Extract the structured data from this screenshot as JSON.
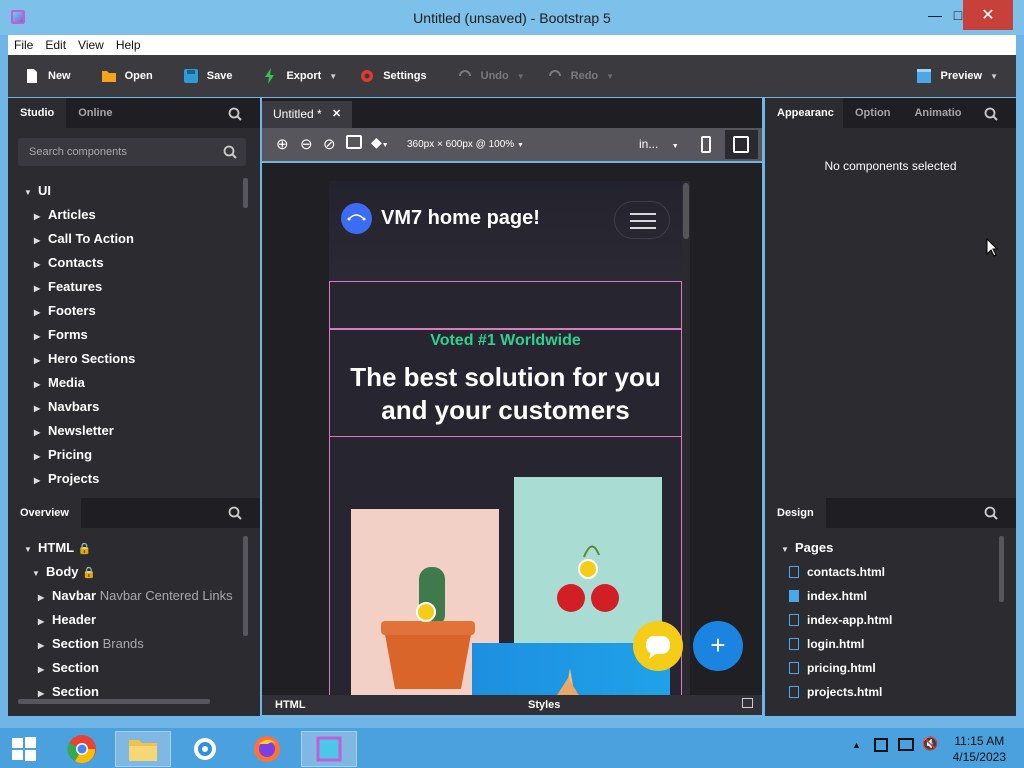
{
  "window": {
    "title": "Untitled (unsaved) - Bootstrap 5"
  },
  "menu": [
    "File",
    "Edit",
    "View",
    "Help"
  ],
  "toolbar": {
    "new": "New",
    "open": "Open",
    "save": "Save",
    "export": "Export",
    "settings": "Settings",
    "undo": "Undo",
    "redo": "Redo",
    "preview": "Preview"
  },
  "left_panel": {
    "tabs": [
      "Studio",
      "Online"
    ],
    "search_placeholder": "Search components",
    "root": "UI",
    "categories": [
      "Articles",
      "Call To Action",
      "Contacts",
      "Features",
      "Footers",
      "Forms",
      "Hero Sections",
      "Media",
      "Navbars",
      "Newsletter",
      "Pricing",
      "Projects"
    ]
  },
  "overview": {
    "title": "Overview",
    "items": [
      {
        "label": "HTML",
        "sub": ""
      },
      {
        "label": "Body",
        "sub": ""
      },
      {
        "label": "Navbar",
        "sub": "Navbar Centered Links"
      },
      {
        "label": "Header",
        "sub": ""
      },
      {
        "label": "Section",
        "sub": "Brands"
      },
      {
        "label": "Section",
        "sub": ""
      },
      {
        "label": "Section",
        "sub": ""
      }
    ]
  },
  "editor": {
    "tab_label": "Untitled *",
    "viewport": "360px × 600px @ 100%",
    "insert_label": "in...",
    "bottom_html": "HTML",
    "bottom_styles": "Styles"
  },
  "preview": {
    "brand": "VM7 home page!",
    "kicker": "Voted #1 Worldwide",
    "headline_line1": "The best solution for you",
    "headline_line2": "and your customers"
  },
  "right_panel": {
    "tabs": [
      "Appearanc",
      "Option",
      "Animatio"
    ],
    "empty_text": "No components selected"
  },
  "design": {
    "title": "Design",
    "section": "Pages",
    "pages": [
      "contacts.html",
      "index.html",
      "index-app.html",
      "login.html",
      "pricing.html",
      "projects.html"
    ]
  },
  "taskbar": {
    "time": "11:15 AM",
    "date": "4/15/2023"
  },
  "colors": {
    "toolbar": "#3a3a3f",
    "panel": "#2b2b30",
    "accent_green": "#2fd090",
    "fab_blue": "#1b84e0",
    "fab_yellow": "#f5cc17"
  }
}
